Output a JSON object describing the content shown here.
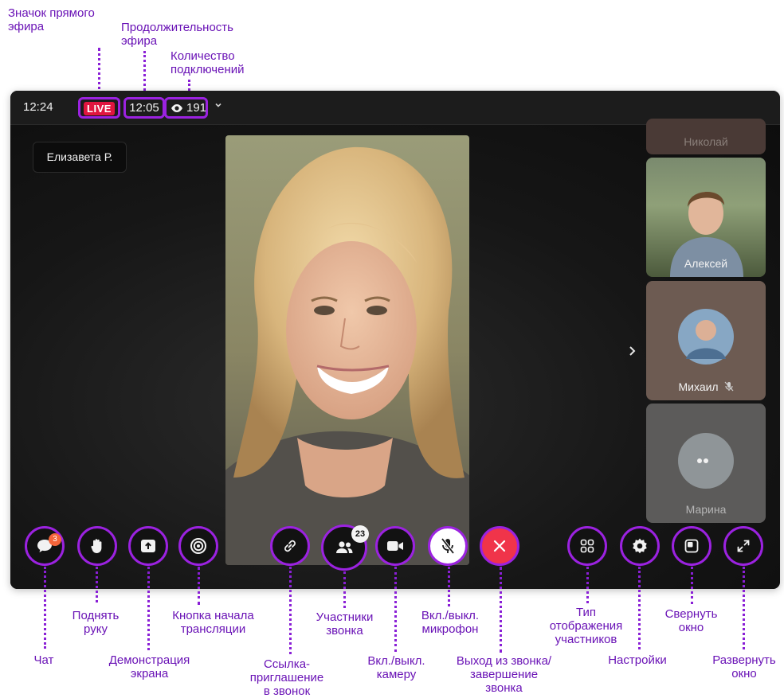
{
  "annotations": {
    "live_icon": "Значок прямого\nэфира",
    "duration": "Продолжительность\nэфира",
    "connections": "Количество\nподключений",
    "chat": "Чат",
    "raise_hand": "Поднять\nруку",
    "screen_share": "Демонстрация\nэкрана",
    "broadcast": "Кнопка начала\nтрансляции",
    "invite_link": "Ссылка-\nприглашение\nв звонок",
    "participants": "Участники\nзвонка",
    "camera": "Вкл./выкл.\nкамеру",
    "microphone": "Вкл./выкл.\nмикрофон",
    "end_call": "Выход из звонка/\nзавершение\nзвонка",
    "layout": "Тип\nотображения\nучастников",
    "settings": "Настройки",
    "minimize": "Свернуть\nокно",
    "maximize": "Развернуть\nокно"
  },
  "topbar": {
    "clock": "12:24",
    "live_label": "LIVE",
    "duration": "12:05",
    "viewers": "191"
  },
  "stage": {
    "speaker_name": "Елизавета Р."
  },
  "participants_tiles": [
    {
      "name": "Николай"
    },
    {
      "name": "Алексей"
    },
    {
      "name": "Михаил",
      "muted": true
    },
    {
      "name": "Марина"
    }
  ],
  "controls": {
    "chat_badge": "3",
    "participants_badge": "23"
  },
  "colors": {
    "accent": "#9b22e0",
    "live": "#e0153f",
    "end_call": "#f0344a",
    "annotation_text": "#6a13b6"
  },
  "icons": [
    "chat-icon",
    "hand-icon",
    "upload-icon",
    "broadcast-icon",
    "link-icon",
    "people-icon",
    "camera-icon",
    "mic-off-icon",
    "close-icon",
    "grid-icon",
    "gear-icon",
    "minimize-icon",
    "expand-icon",
    "eye-icon",
    "chevron-down-icon",
    "chevron-right-icon"
  ]
}
